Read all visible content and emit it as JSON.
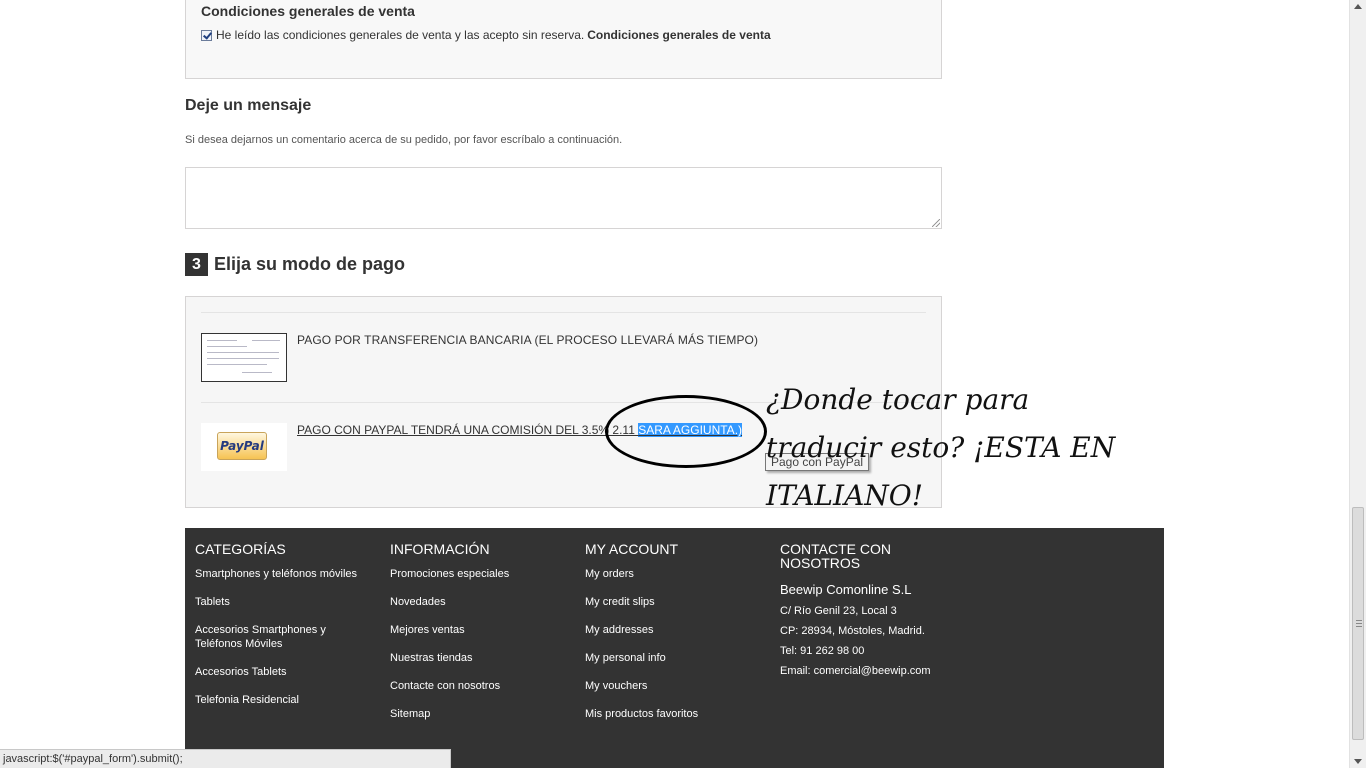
{
  "terms": {
    "title": "Condiciones generales de venta",
    "checkbox_checked": true,
    "text": "He leído las condiciones generales de venta y las acepto sin reserva.",
    "link": "Condiciones generales de venta"
  },
  "message": {
    "title": "Deje un mensaje",
    "description": "Si desea dejarnos un comentario acerca de su pedido, por favor escríbalo a continuación.",
    "value": ""
  },
  "payment": {
    "step_number": "3",
    "title": "Elija su modo de pago",
    "bank_label": "PAGO POR TRANSFERENCIA BANCARIA (EL PROCESO LLEVARÁ MÁS TIEMPO)",
    "paypal_label_prefix": "PAGO CON PAYPAL TENDRÁ UNA COMISIÓN DEL 3.5% 2.11 ",
    "paypal_label_highlight": "SARA AGGIUNTA.)",
    "paypal_logo_text": "PayPal",
    "tooltip": "Pago con PayPal"
  },
  "annotation": {
    "line1": "¿Donde tocar para",
    "line2": "traducir esto? ¡ESTA EN",
    "line3": "ITALIANO!"
  },
  "footer": {
    "categories": {
      "title": "CATEGORÍAS",
      "items": [
        "Smartphones y teléfonos móviles",
        "Tablets",
        "Accesorios Smartphones y Teléfonos Móviles",
        "Accesorios Tablets",
        "Telefonia Residencial"
      ]
    },
    "info": {
      "title": "INFORMACIÓN",
      "items": [
        "Promociones especiales",
        "Novedades",
        "Mejores ventas",
        "Nuestras tiendas",
        "Contacte con nosotros",
        "Sitemap"
      ]
    },
    "account": {
      "title": "MY ACCOUNT",
      "items": [
        "My orders",
        "My credit slips",
        "My addresses",
        "My personal info",
        "My vouchers",
        "Mis productos favoritos"
      ]
    },
    "contact": {
      "title": "CONTACTE CON NOSOTROS",
      "company": "Beewip Comonline S.L",
      "address": "C/ Río Genil 23, Local 3",
      "postal": "CP: 28934, Móstoles, Madrid.",
      "phone": "Tel: 91 262 98 00",
      "email": "Email: comercial@beewip.com"
    }
  },
  "status_bar": "javascript:$('#paypal_form').submit();"
}
